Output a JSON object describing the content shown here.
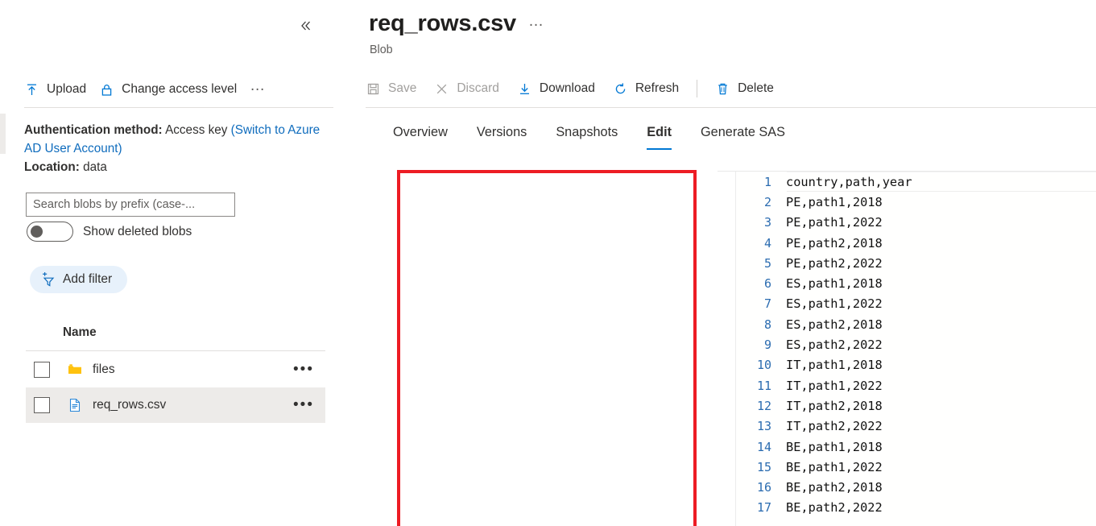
{
  "left_panel": {
    "collapse_icon": "chevron-double-left-icon",
    "toolbar": [
      {
        "label": "Upload",
        "icon": "upload-icon"
      },
      {
        "label": "Change access level",
        "icon": "lock-icon"
      },
      {
        "label": "…",
        "icon": "more-icon"
      }
    ],
    "auth": {
      "method_label": "Authentication method:",
      "method_value": "Access key",
      "switch_link": "(Switch to Azure AD User Account)",
      "location_label": "Location:",
      "location_value": "data"
    },
    "search": {
      "placeholder": "Search blobs by prefix (case-...",
      "value": ""
    },
    "toggle": {
      "label": "Show deleted blobs",
      "state": "off"
    },
    "add_filter": {
      "label": "Add filter",
      "icon": "add-filter-icon",
      "bg": "#e7f1fb"
    },
    "list": {
      "column_header": "Name",
      "rows": [
        {
          "name": "files",
          "icon": "folder-icon",
          "selected": false,
          "menu": "•••"
        },
        {
          "name": "req_rows.csv",
          "icon": "file-csv-icon",
          "selected": true,
          "menu": "•••"
        }
      ]
    }
  },
  "right_panel": {
    "title": "req_rows.csv",
    "title_menu": "…",
    "subtitle": "Blob",
    "toolbar": [
      {
        "label": "Save",
        "icon": "save-icon",
        "disabled": true
      },
      {
        "label": "Discard",
        "icon": "discard-icon",
        "disabled": true
      },
      {
        "label": "Download",
        "icon": "download-icon",
        "disabled": false
      },
      {
        "label": "Refresh",
        "icon": "refresh-icon",
        "disabled": false
      },
      {
        "label": "Delete",
        "icon": "delete-icon",
        "disabled": false
      }
    ],
    "tabs": [
      {
        "label": "Overview",
        "active": false
      },
      {
        "label": "Versions",
        "active": false
      },
      {
        "label": "Snapshots",
        "active": false
      },
      {
        "label": "Edit",
        "active": true
      },
      {
        "label": "Generate SAS",
        "active": false
      }
    ],
    "accent_color": "#0078d4",
    "editor": {
      "active_line": 1,
      "lines": [
        {
          "n": "1",
          "text": "country,path,year"
        },
        {
          "n": "2",
          "text": "PE,path1,2018"
        },
        {
          "n": "3",
          "text": "PE,path1,2022"
        },
        {
          "n": "4",
          "text": "PE,path2,2018"
        },
        {
          "n": "5",
          "text": "PE,path2,2022"
        },
        {
          "n": "6",
          "text": "ES,path1,2018"
        },
        {
          "n": "7",
          "text": "ES,path1,2022"
        },
        {
          "n": "8",
          "text": "ES,path2,2018"
        },
        {
          "n": "9",
          "text": "ES,path2,2022"
        },
        {
          "n": "10",
          "text": "IT,path1,2018"
        },
        {
          "n": "11",
          "text": "IT,path1,2022"
        },
        {
          "n": "12",
          "text": "IT,path2,2018"
        },
        {
          "n": "13",
          "text": "IT,path2,2022"
        },
        {
          "n": "14",
          "text": "BE,path1,2018"
        },
        {
          "n": "15",
          "text": "BE,path1,2022"
        },
        {
          "n": "16",
          "text": "BE,path2,2018"
        },
        {
          "n": "17",
          "text": "BE,path2,2022"
        }
      ]
    }
  },
  "annotation": {
    "type": "red-rectangle-highlight",
    "color": "#ed1c24"
  }
}
